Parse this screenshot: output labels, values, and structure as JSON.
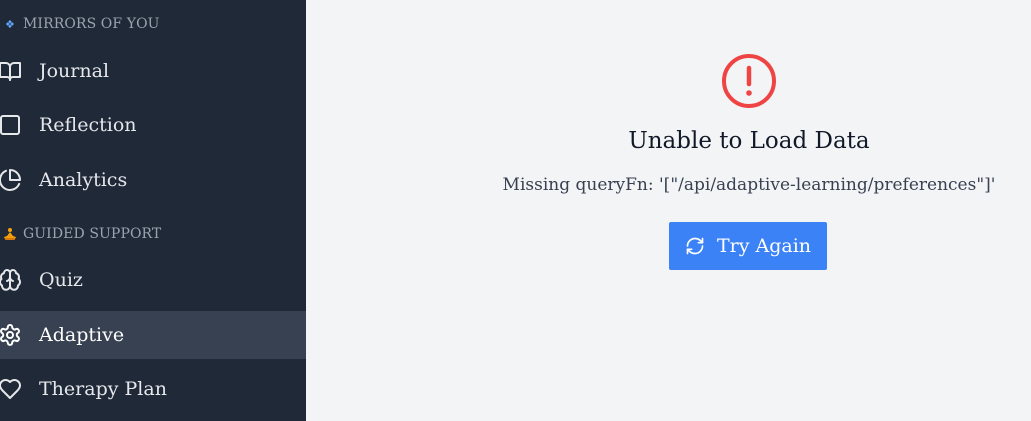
{
  "sidebar": {
    "sections": [
      {
        "header": "MIRRORS OF YOU",
        "icon": "diamond-icon",
        "icon_char": "❖",
        "items": [
          {
            "label": "Journal",
            "icon": "book-open-icon",
            "active": false
          },
          {
            "label": "Reflection",
            "icon": "square-icon",
            "active": false
          },
          {
            "label": "Analytics",
            "icon": "pie-chart-icon",
            "active": false
          }
        ]
      },
      {
        "header": "GUIDED SUPPORT",
        "icon": "meditation-icon",
        "icon_char": "🧘",
        "items": [
          {
            "label": "Quiz",
            "icon": "brain-icon",
            "active": false
          },
          {
            "label": "Adaptive",
            "icon": "gear-icon",
            "active": true
          },
          {
            "label": "Therapy Plan",
            "icon": "heart-icon",
            "active": false
          }
        ]
      }
    ]
  },
  "main": {
    "error": {
      "icon": "alert-circle-icon",
      "title": "Unable to Load Data",
      "message": "Missing queryFn: '[\"/api/adaptive-learning/preferences\"]'",
      "retry_label": "Try Again",
      "retry_icon": "refresh-icon"
    }
  },
  "colors": {
    "sidebar_bg": "#1f2937",
    "sidebar_active_bg": "#374151",
    "main_bg": "#f3f4f6",
    "error_red": "#ef4444",
    "button_blue": "#3b82f6",
    "diamond_blue": "#60a5fa"
  }
}
